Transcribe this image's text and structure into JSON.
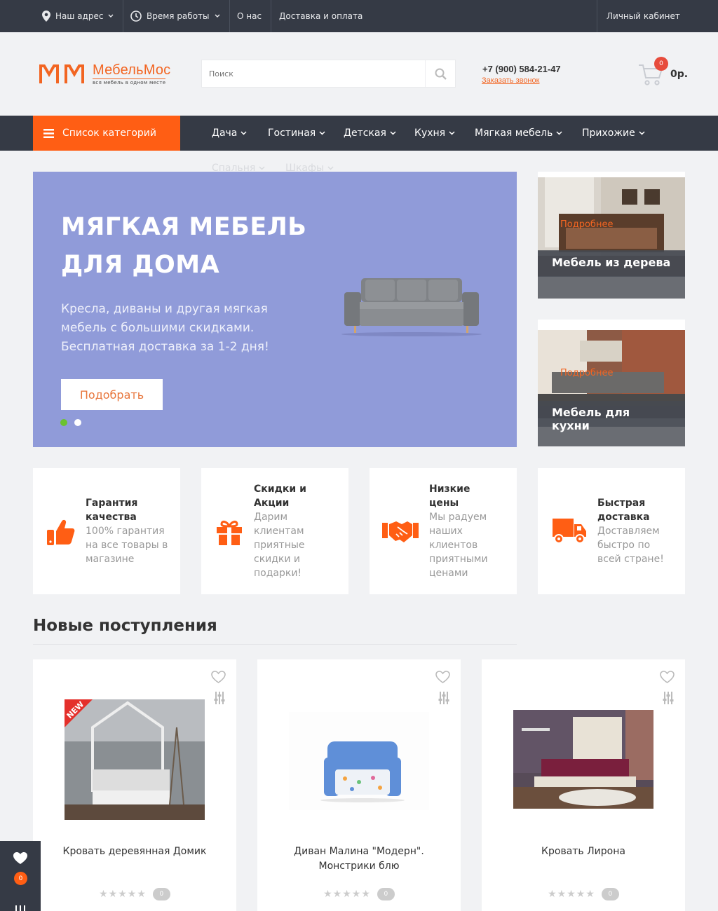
{
  "topbar": {
    "address": "Наш адрес",
    "hours": "Время работы",
    "about": "О нас",
    "delivery": "Доставка и оплата",
    "account": "Личный кабинет"
  },
  "header": {
    "logo_name": "МебельМос",
    "logo_tagline": "вся мебель в одном месте",
    "search_placeholder": "Поиск",
    "phone": "+7 (900) 584-21-47",
    "callback": "Заказать звонок",
    "cart_count": "0",
    "cart_sum": "0р."
  },
  "nav": {
    "categories_button": "Список категорий",
    "items": [
      "Дача",
      "Гостиная",
      "Детская",
      "Кухня",
      "Мягкая мебель",
      "Прихожие",
      "Спальня",
      "Шкафы"
    ]
  },
  "hero": {
    "title_line1": "МЯГКАЯ МЕБЕЛЬ",
    "title_line2": "ДЛЯ ДОМА",
    "text": "Кресла, диваны и другая мягкая мебель с большими скидками. Бесплатная доставка за 1-2 дня!",
    "button": "Подобрать",
    "active_dot": "#6bc22f",
    "dot": "#ffffff",
    "background": "#909bd9"
  },
  "side_banners": [
    {
      "link": "Подробнее",
      "caption": "Мебель из дерева"
    },
    {
      "link": "Подробнее",
      "caption": "Мебель для кухни"
    }
  ],
  "features": [
    {
      "icon": "thumbs-up-icon",
      "title": "Гарантия качества",
      "text": "100% гарантия на все товары в магазине"
    },
    {
      "icon": "gift-icon",
      "title": "Скидки и Акции",
      "text": "Дарим клиентам приятные скидки и подарки!"
    },
    {
      "icon": "handshake-icon",
      "title": "Низкие цены",
      "text": "Мы радуем наших клиентов приятными ценами"
    },
    {
      "icon": "truck-icon",
      "title": "Быстрая доставка",
      "text": "Доставляем быстро по всей стране!"
    }
  ],
  "new_arrivals": {
    "title": "Новые поступления",
    "products": [
      {
        "name": "Кровать деревянная Домик",
        "badge": "NEW",
        "rating": "★★★★★",
        "reviews": "0"
      },
      {
        "name": "Диван Малина \"Модерн\". Монстрики блю",
        "rating": "★★★★★",
        "reviews": "0"
      },
      {
        "name": "Кровать Лирона",
        "rating": "★★★★★",
        "reviews": "0"
      }
    ]
  },
  "fixed_panel": {
    "wishlist_count": "0"
  },
  "colors": {
    "accent": "#ff5e14",
    "dark": "#353a45"
  }
}
